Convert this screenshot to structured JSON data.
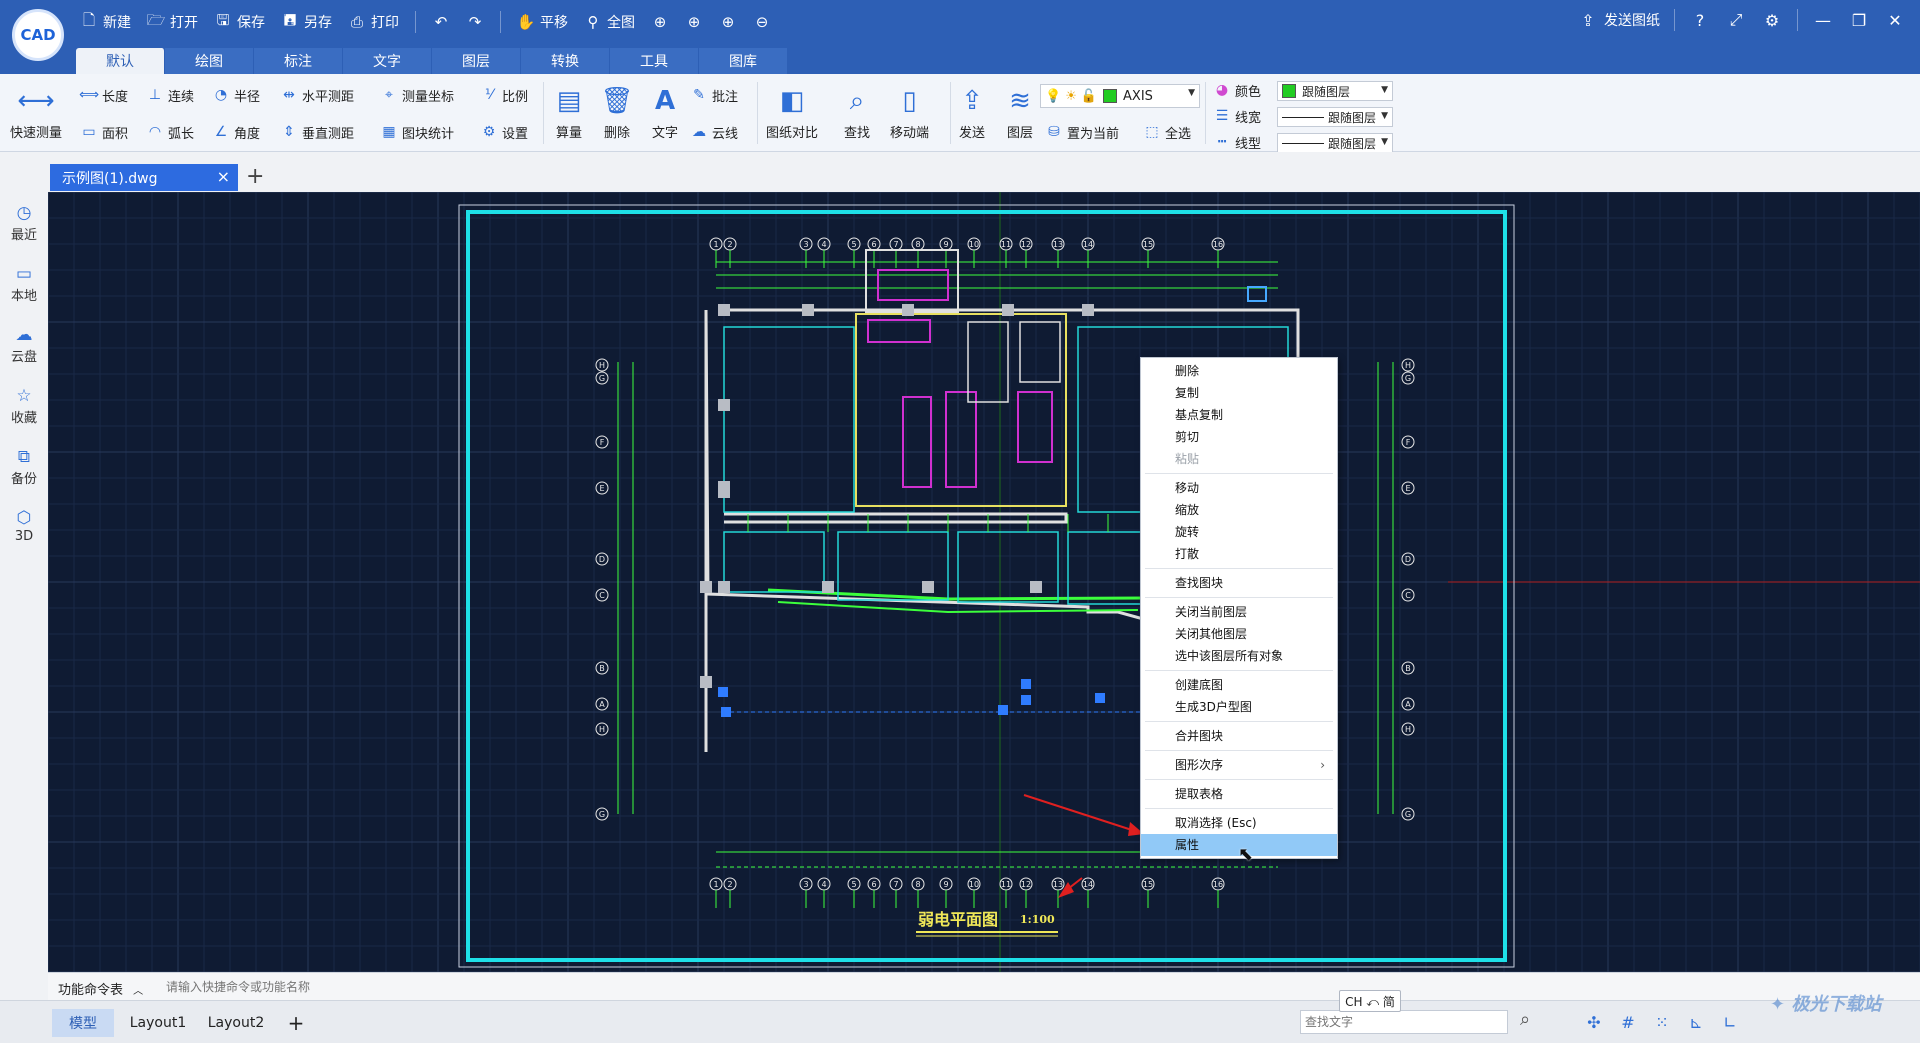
{
  "app": {
    "logo_text": "CAD"
  },
  "quick_access": [
    {
      "icon": "new-file-icon",
      "label": "新建"
    },
    {
      "icon": "open-folder-icon",
      "label": "打开"
    },
    {
      "icon": "save-icon",
      "label": "保存"
    },
    {
      "icon": "save-as-icon",
      "label": "另存"
    },
    {
      "icon": "print-icon",
      "label": "打印"
    }
  ],
  "quick_tools": [
    {
      "icon": "pan-hand-icon",
      "label": "平移"
    },
    {
      "icon": "zoom-extents-icon",
      "label": "全图"
    }
  ],
  "title_right": {
    "send_label": "发送图纸"
  },
  "tabs": [
    "默认",
    "绘图",
    "标注",
    "文字",
    "图层",
    "转换",
    "工具",
    "图库"
  ],
  "ribbon": {
    "quick_measure": "快速测量",
    "measure_col1": [
      "长度",
      "面积"
    ],
    "measure_col2": [
      "连续",
      "弧长"
    ],
    "measure_col3": [
      "半径",
      "角度"
    ],
    "measure_col4": [
      "水平测距",
      "垂直测距"
    ],
    "measure_col5": [
      "测量坐标",
      "图块统计"
    ],
    "measure_col6": [
      "比例",
      "设置"
    ],
    "big_buttons": [
      "算量",
      "删除",
      "文字"
    ],
    "annotate": [
      "批注",
      "云线"
    ],
    "compare": "图纸对比",
    "find": "查找",
    "mobile": "移动端",
    "send": "发送",
    "layer": "图层",
    "layer_name": "AXIS",
    "set_current": "置为当前",
    "select_all": "全选",
    "prop_labels": [
      "颜色",
      "线宽",
      "线型"
    ],
    "prop_values": [
      "跟随图层",
      "跟随图层",
      "跟随图层"
    ],
    "layer_color": "#22cc22"
  },
  "document": {
    "tab_name": "示例图(1).dwg"
  },
  "sidebar": [
    "最近",
    "本地",
    "云盘",
    "收藏",
    "备份",
    "3D"
  ],
  "drawing": {
    "title": "弱电平面图",
    "scale": "1:100",
    "axis_top": [
      "1",
      "2",
      "3",
      "4",
      "5",
      "6",
      "7",
      "8",
      "9",
      "10",
      "11",
      "12",
      "13",
      "14",
      "15",
      "16"
    ],
    "axis_side": [
      "H",
      "G",
      "F",
      "E",
      "D",
      "C",
      "B",
      "A"
    ]
  },
  "context_menu": [
    {
      "label": "删除"
    },
    {
      "label": "复制"
    },
    {
      "label": "基点复制"
    },
    {
      "label": "剪切"
    },
    {
      "label": "粘贴",
      "disabled": true
    },
    {
      "sep": true
    },
    {
      "label": "移动"
    },
    {
      "label": "缩放"
    },
    {
      "label": "旋转"
    },
    {
      "label": "打散"
    },
    {
      "sep": true
    },
    {
      "label": "查找图块"
    },
    {
      "sep": true
    },
    {
      "label": "关闭当前图层"
    },
    {
      "label": "关闭其他图层"
    },
    {
      "label": "选中该图层所有对象"
    },
    {
      "sep": true
    },
    {
      "label": "创建底图"
    },
    {
      "label": "生成3D户型图"
    },
    {
      "sep": true
    },
    {
      "label": "合并图块"
    },
    {
      "sep": true
    },
    {
      "label": "图形次序",
      "submenu": true
    },
    {
      "sep": true
    },
    {
      "label": "提取表格"
    },
    {
      "sep": true
    },
    {
      "label": "取消选择 (Esc)"
    },
    {
      "label": "属性",
      "highlight": true
    }
  ],
  "command": {
    "label": "功能命令表",
    "placeholder": "请输入快捷命令或功能名称"
  },
  "layouts": [
    "模型",
    "Layout1",
    "Layout2"
  ],
  "status": {
    "ime": "CH ⤺ 简",
    "search_placeholder": "查找文字"
  },
  "watermark": "极光下载站"
}
